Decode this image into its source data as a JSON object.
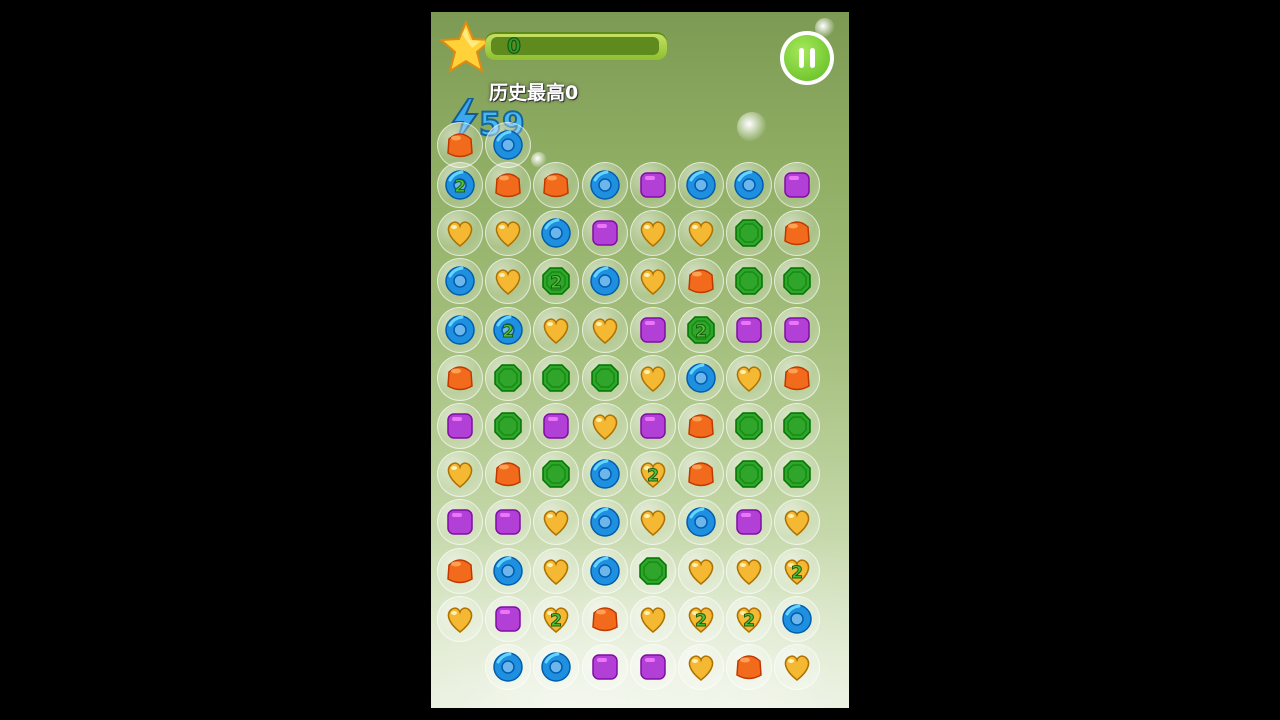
{
  "hud": {
    "score": "0",
    "best_label": "历史最高0",
    "moves": "59"
  },
  "colors": {
    "orange": "#f26a1b",
    "blue": "#1f8fe0",
    "purple": "#b23fd6",
    "gold": "#f5b833",
    "green": "#2fa52c"
  },
  "board": {
    "rows": [
      [
        "blue2",
        "orange",
        "orange",
        "blue",
        "purple",
        "blue",
        "blue",
        "purple"
      ],
      [
        "gold",
        "gold",
        "blue",
        "purple",
        "gold",
        "gold",
        "green",
        "orange"
      ],
      [
        "blue",
        "gold",
        "green2",
        "blue",
        "gold",
        "orange",
        "green",
        "green"
      ],
      [
        "blue",
        "blue2",
        "gold",
        "gold",
        "purple",
        "green2",
        "purple",
        "purple"
      ],
      [
        "orange",
        "green",
        "green",
        "green",
        "gold",
        "blue",
        "gold",
        "orange"
      ],
      [
        "purple",
        "green",
        "purple",
        "gold",
        "purple",
        "orange",
        "green",
        "green"
      ],
      [
        "gold",
        "orange",
        "green",
        "blue",
        "gold2",
        "orange",
        "green",
        "green"
      ],
      [
        "purple",
        "purple",
        "gold",
        "blue",
        "gold",
        "blue",
        "purple",
        "gold"
      ],
      [
        "orange",
        "blue",
        "gold",
        "blue",
        "green",
        "gold",
        "gold",
        "gold2"
      ],
      [
        "gold",
        "purple",
        "gold2",
        "orange",
        "gold",
        "gold2",
        "gold2",
        "blue"
      ],
      [
        "",
        "blue",
        "blue",
        "purple",
        "purple",
        "gold",
        "orange",
        "gold"
      ]
    ],
    "partial_top_row": [
      "orange",
      "blue"
    ]
  }
}
